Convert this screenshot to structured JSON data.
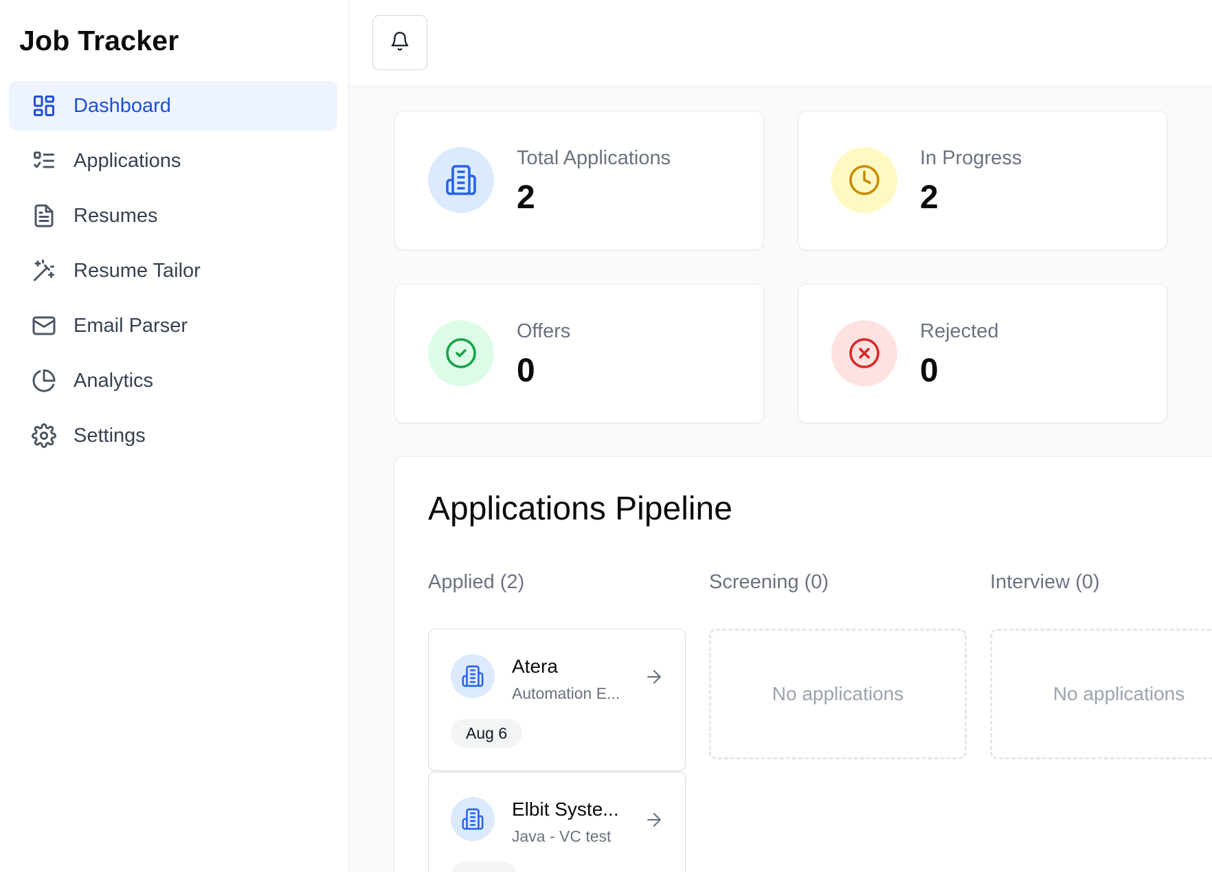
{
  "sidebar": {
    "brand": "Job Tracker",
    "items": [
      {
        "label": "Dashboard",
        "icon": "dashboard-grid-icon",
        "active": true
      },
      {
        "label": "Applications",
        "icon": "list-checks-icon"
      },
      {
        "label": "Resumes",
        "icon": "document-icon"
      },
      {
        "label": "Resume Tailor",
        "icon": "magic-wand-icon"
      },
      {
        "label": "Email Parser",
        "icon": "mail-icon"
      },
      {
        "label": "Analytics",
        "icon": "pie-chart-icon"
      },
      {
        "label": "Settings",
        "icon": "gear-icon"
      }
    ]
  },
  "topbar": {
    "notifications_icon": "bell-icon"
  },
  "stats": [
    {
      "label": "Total Applications",
      "value": "2",
      "icon": "building-icon",
      "icon_color": "#2563eb",
      "icon_bg": "#dbeafe"
    },
    {
      "label": "In Progress",
      "value": "2",
      "icon": "clock-icon",
      "icon_color": "#ca8a04",
      "icon_bg": "#fef9c3"
    },
    {
      "label": "Offers",
      "value": "0",
      "icon": "check-circle-icon",
      "icon_color": "#16a34a",
      "icon_bg": "#dcfce7"
    },
    {
      "label": "Rejected",
      "value": "0",
      "icon": "x-circle-icon",
      "icon_color": "#dc2626",
      "icon_bg": "#fee2e2"
    }
  ],
  "pipeline": {
    "title": "Applications Pipeline",
    "columns": [
      {
        "title": "Applied (2)",
        "cards": [
          {
            "company": "Atera",
            "role": "Automation E...",
            "date": "Aug 6"
          },
          {
            "company": "Elbit Syste...",
            "role": "Java - VC test",
            "date": ""
          }
        ]
      },
      {
        "title": "Screening (0)",
        "empty_text": "No applications"
      },
      {
        "title": "Interview (0)",
        "empty_text": "No applications"
      }
    ]
  },
  "colors": {
    "accent": "#1d4ed8",
    "active_bg": "#eef4ff",
    "border": "#e5e7eb",
    "muted_text": "#6b7280"
  }
}
